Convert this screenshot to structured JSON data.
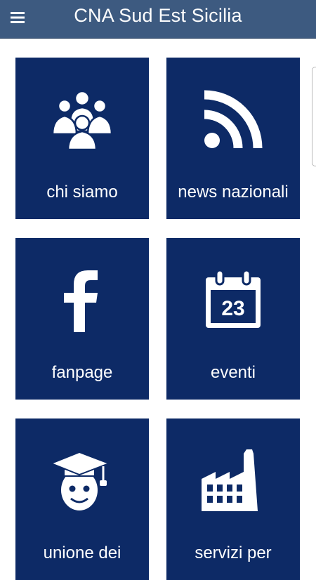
{
  "app": {
    "title": "CNA Sud Est Sicilia",
    "menu_icon": "hamburger-menu-icon"
  },
  "colors": {
    "app_bar": "#3d5a80",
    "tile_background": "#0d2a66",
    "tile_text": "#ffffff",
    "page_background": "#ffffff"
  },
  "tiles": [
    {
      "label": "chi siamo",
      "icon": "people-group-icon"
    },
    {
      "label": "news nazionali",
      "icon": "rss-feed-icon"
    },
    {
      "label": "fanpage",
      "icon": "facebook-icon"
    },
    {
      "label": "eventi",
      "icon": "calendar-icon",
      "icon_text": "23"
    },
    {
      "label": "unione dei",
      "icon": "graduate-icon"
    },
    {
      "label": "servizi per",
      "icon": "factory-icon"
    }
  ]
}
